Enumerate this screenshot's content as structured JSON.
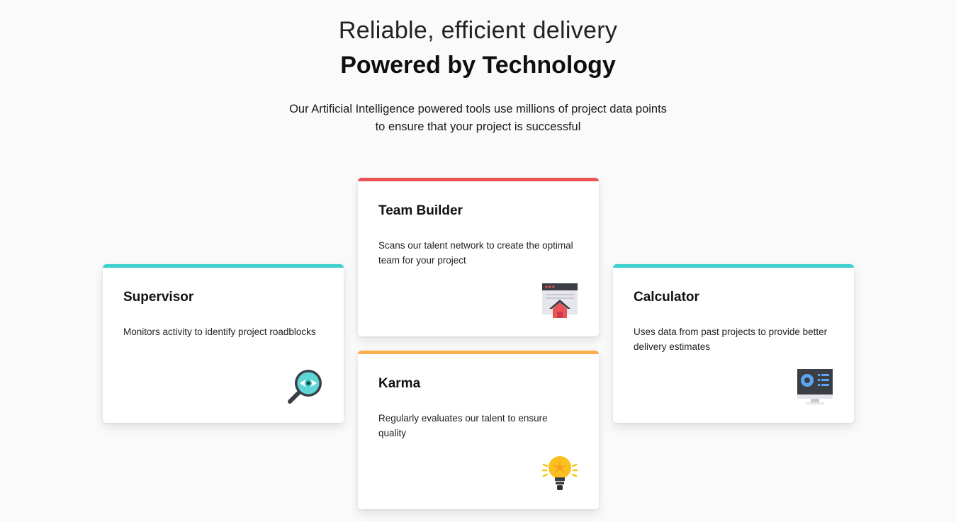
{
  "header": {
    "title_light": "Reliable, efficient delivery",
    "title_bold": "Powered by Technology",
    "description": "Our Artificial Intelligence powered tools use millions of project data points to ensure that your project is successful"
  },
  "cards": [
    {
      "id": "supervisor",
      "title": "Supervisor",
      "description": "Monitors activity to identify project roadblocks",
      "accent": "#3ecfcf",
      "icon": "magnifier-eye-icon"
    },
    {
      "id": "teambuilder",
      "title": "Team Builder",
      "description": "Scans our talent network to create the optimal team for your project",
      "accent": "#ea5454",
      "icon": "browser-house-icon"
    },
    {
      "id": "karma",
      "title": "Karma",
      "description": "Regularly evaluates our talent to ensure quality",
      "accent": "#fcaf4a",
      "icon": "lightbulb-icon"
    },
    {
      "id": "calculator",
      "title": "Calculator",
      "description": "Uses data from past projects to provide better delivery estimates",
      "accent": "#3ecfcf",
      "icon": "monitor-chart-icon"
    }
  ]
}
